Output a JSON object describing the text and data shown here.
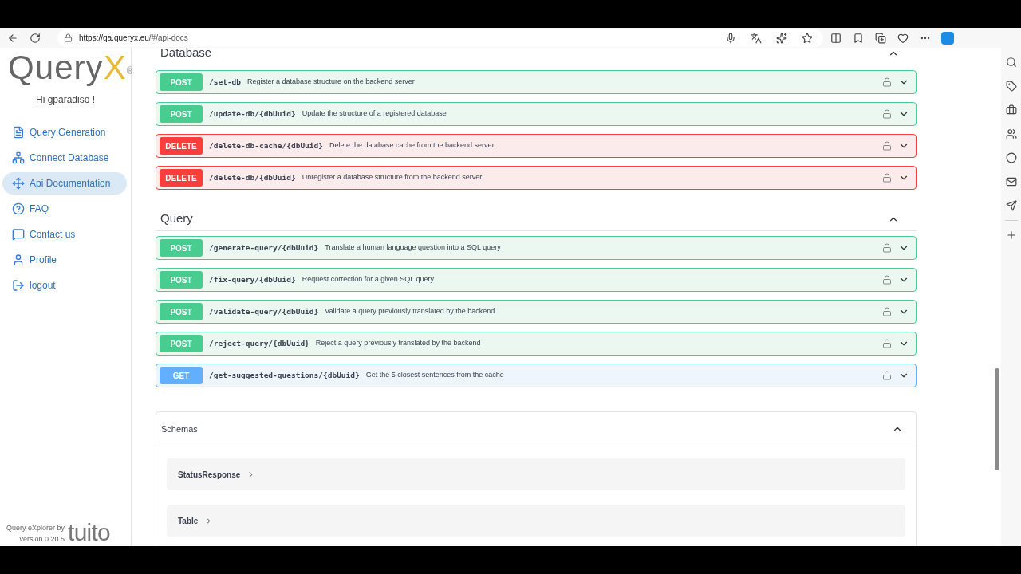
{
  "browser": {
    "url_host": "https://qa.queryx.eu",
    "url_path": "/#/api-docs"
  },
  "sidebar": {
    "logo_text": "Query",
    "logo_accent": "X",
    "logo_mark": "®",
    "greeting": "Hi gparadiso !",
    "items": [
      {
        "label": "Query Generation",
        "selected": false
      },
      {
        "label": "Connect Database",
        "selected": false
      },
      {
        "label": "Api Documentation",
        "selected": true
      },
      {
        "label": "FAQ",
        "selected": false
      },
      {
        "label": "Contact us",
        "selected": false
      },
      {
        "label": "Profile",
        "selected": false
      },
      {
        "label": "logout",
        "selected": false
      }
    ],
    "footer": {
      "byline": "Query eXplorer by",
      "version": "version 0.20.5",
      "brand": "tuito"
    }
  },
  "sections": [
    {
      "title": "Database",
      "expanded": true,
      "operations": [
        {
          "kind": "post",
          "method": "POST",
          "path": "/set-db",
          "summary": "Register a database structure on the backend server"
        },
        {
          "kind": "post",
          "method": "POST",
          "path": "/update-db/{dbUuid}",
          "summary": "Update the structure of a registered database"
        },
        {
          "kind": "delete",
          "method": "DELETE",
          "path": "/delete-db-cache/{dbUuid}",
          "summary": "Delete the database cache from the backend server"
        },
        {
          "kind": "delete",
          "method": "DELETE",
          "path": "/delete-db/{dbUuid}",
          "summary": "Unregister a database structure from the backend server"
        }
      ]
    },
    {
      "title": "Query",
      "expanded": true,
      "operations": [
        {
          "kind": "post",
          "method": "POST",
          "path": "/generate-query/{dbUuid}",
          "summary": "Translate a human language question into a SQL query"
        },
        {
          "kind": "post",
          "method": "POST",
          "path": "/fix-query/{dbUuid}",
          "summary": "Request correction for a given SQL query"
        },
        {
          "kind": "post",
          "method": "POST",
          "path": "/validate-query/{dbUuid}",
          "summary": "Validate a query previously translated by the backend"
        },
        {
          "kind": "post",
          "method": "POST",
          "path": "/reject-query/{dbUuid}",
          "summary": "Reject a query previously translated by the backend"
        },
        {
          "kind": "get",
          "method": "GET",
          "path": "/get-suggested-questions/{dbUuid}",
          "summary": "Get the 5 closest sentences from the cache"
        }
      ]
    }
  ],
  "schemas": {
    "title": "Schemas",
    "expanded": true,
    "items": [
      {
        "name": "StatusResponse"
      },
      {
        "name": "Table"
      }
    ]
  }
}
